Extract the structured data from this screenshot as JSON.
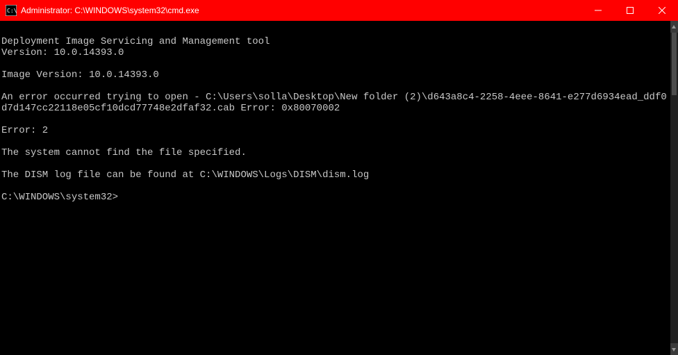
{
  "titlebar": {
    "title": "Administrator: C:\\WINDOWS\\system32\\cmd.exe"
  },
  "console": {
    "lines": [
      "",
      "Deployment Image Servicing and Management tool",
      "Version: 10.0.14393.0",
      "",
      "Image Version: 10.0.14393.0",
      "",
      "An error occurred trying to open - C:\\Users\\solla\\Desktop\\New folder (2)\\d643a8c4-2258-4eee-8641-e277d6934ead_ddf0d7d147cc22118e05cf10dcd77748e2dfaf32.cab Error: 0x80070002",
      "",
      "Error: 2",
      "",
      "The system cannot find the file specified.",
      "",
      "The DISM log file can be found at C:\\WINDOWS\\Logs\\DISM\\dism.log",
      ""
    ],
    "prompt": "C:\\WINDOWS\\system32>"
  }
}
